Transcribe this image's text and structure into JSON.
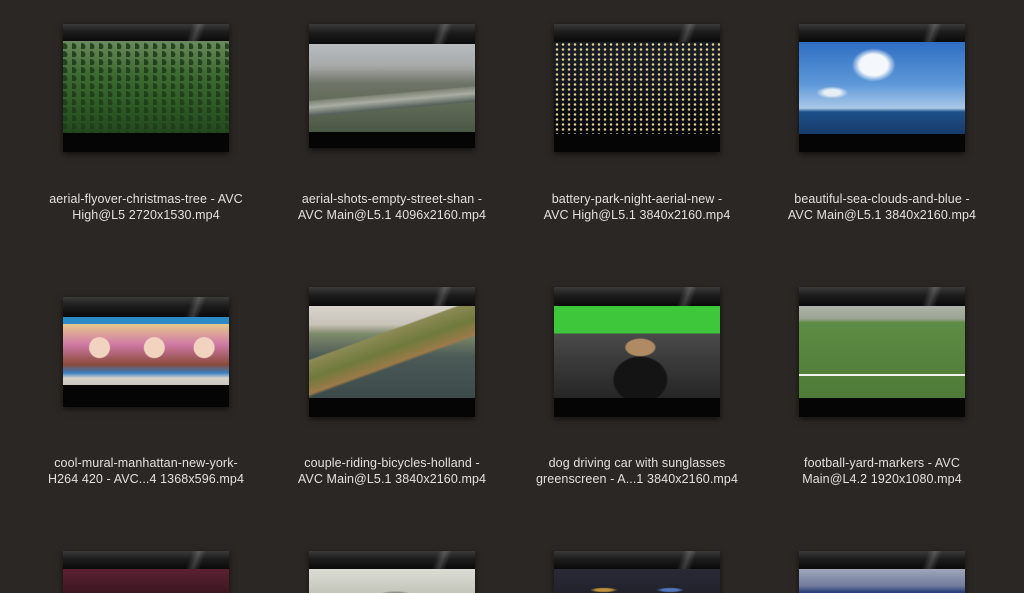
{
  "files": [
    {
      "line1": "aerial-flyover-christmas-tree - AVC",
      "line2": "High@L5 2720x1530.mp4",
      "thumb": "forest"
    },
    {
      "line1": "aerial-shots-empty-street-shan -",
      "line2": "AVC Main@L5.1 4096x2160.mp4",
      "thumb": "bridge-city"
    },
    {
      "line1": "battery-park-night-aerial-new -",
      "line2": "AVC High@L5.1 3840x2160.mp4",
      "thumb": "night-skyline"
    },
    {
      "line1": "beautiful-sea-clouds-and-blue -",
      "line2": "AVC Main@L5.1 3840x2160.mp4",
      "thumb": "sea-clouds"
    },
    {
      "line1": "cool-mural-manhattan-new-york-",
      "line2": "H264 420 - AVC...4 1368x596.mp4",
      "thumb": "mural"
    },
    {
      "line1": "couple-riding-bicycles-holland -",
      "line2": "AVC Main@L5.1 3840x2160.mp4",
      "thumb": "dike"
    },
    {
      "line1": "dog driving car with sunglasses",
      "line2": "greenscreen - A...1 3840x2160.mp4",
      "thumb": "dog-car"
    },
    {
      "line1": "football-yard-markers - AVC",
      "line2": "Main@L4.2 1920x1080.mp4",
      "thumb": "football-field"
    },
    {
      "line1": "",
      "line2": "",
      "thumb": "red-dark"
    },
    {
      "line1": "",
      "line2": "",
      "thumb": "dollar-bill"
    },
    {
      "line1": "",
      "line2": "",
      "thumb": "highway-night"
    },
    {
      "line1": "",
      "line2": "",
      "thumb": "stadium"
    }
  ]
}
